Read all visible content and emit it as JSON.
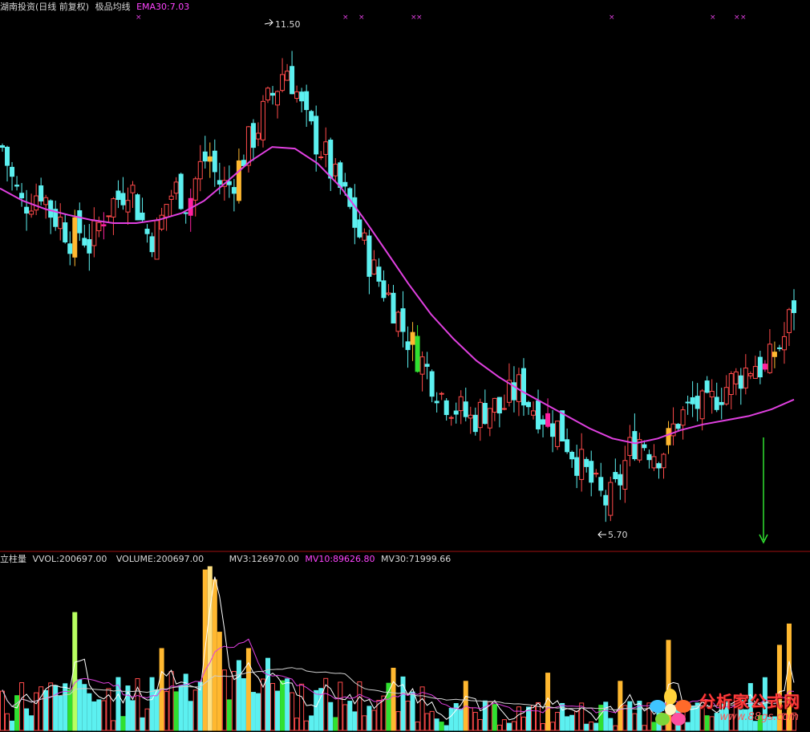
{
  "header": {
    "title": "湖南投资(日线 前复权)",
    "indicator": "极品均线",
    "ema": "EMA30:7.03"
  },
  "volume_header": {
    "name": "立柱量",
    "vvol": "VVOL:200697.00",
    "volume": "VOLUME:200697.00",
    "mv3": "MV3:126970.00",
    "mv10": "MV10:89626.80",
    "mv30": "MV30:71999.66"
  },
  "annotations": {
    "high_label": "11.50",
    "low_label": "5.70"
  },
  "watermark": {
    "title": "分析家公式网",
    "url": "www.88gs.com"
  },
  "colors": {
    "up": "#ff4a4a",
    "down": "#5cf0f0",
    "ema": "#e040e0",
    "signal_yellow": "#ffb830",
    "signal_magenta": "#ff20a0",
    "signal_green": "#30e030",
    "mv_fast": "#ffffff",
    "mv_mid": "#e040e0",
    "mv_slow": "#cfcfcf",
    "divider": "#a01010",
    "marker": "#e040e0"
  },
  "chart_data": [
    {
      "type": "candlestick",
      "title": "湖南投资(日线 前复权)",
      "yrange": [
        5.5,
        11.8
      ],
      "high": 11.5,
      "low": 5.7,
      "ema_label": "EMA30:7.03",
      "close": [
        10.2,
        9.8,
        9.5,
        9.6,
        9.7,
        9.4,
        9.3,
        9.1,
        9.2,
        9.0,
        9.3,
        9.5,
        9.6,
        9.8,
        9.4,
        9.1,
        9.2,
        9.6,
        9.7,
        9.5,
        9.9,
        10.1,
        9.8,
        9.7,
        9.9,
        10.2,
        10.4,
        10.7,
        10.9,
        11.2,
        10.9,
        10.5,
        10.3,
        10.1,
        9.8,
        9.6,
        9.3,
        9.0,
        8.7,
        8.5,
        8.3,
        8.0,
        7.8,
        7.6,
        7.4,
        7.2,
        7.1,
        7.0,
        6.9,
        7.0,
        7.1,
        7.0,
        7.2,
        7.3,
        7.1,
        7.0,
        6.9,
        6.8,
        6.6,
        6.4,
        6.2,
        6.0,
        5.9,
        6.1,
        6.5,
        6.7,
        6.6,
        6.5,
        6.6,
        6.9,
        7.0,
        7.1,
        7.0,
        7.2,
        7.3,
        7.4,
        7.5,
        7.6,
        7.5,
        7.7,
        7.9,
        8.3
      ],
      "ema30": [
        9.7,
        9.55,
        9.45,
        9.38,
        9.32,
        9.28,
        9.28,
        9.32,
        9.4,
        9.55,
        9.78,
        10.02,
        10.2,
        10.18,
        10.0,
        9.72,
        9.35,
        8.95,
        8.55,
        8.18,
        7.88,
        7.62,
        7.42,
        7.25,
        7.1,
        6.95,
        6.8,
        6.68,
        6.62,
        6.68,
        6.78,
        6.85,
        6.9,
        6.95,
        7.03,
        7.15
      ]
    },
    {
      "type": "bar",
      "title": "立柱量",
      "series": [
        {
          "name": "VVOL",
          "last": 200697.0
        },
        {
          "name": "MV3",
          "last": 126970.0
        },
        {
          "name": "MV10",
          "last": 89626.8
        },
        {
          "name": "MV30",
          "last": 71999.66
        }
      ]
    }
  ]
}
